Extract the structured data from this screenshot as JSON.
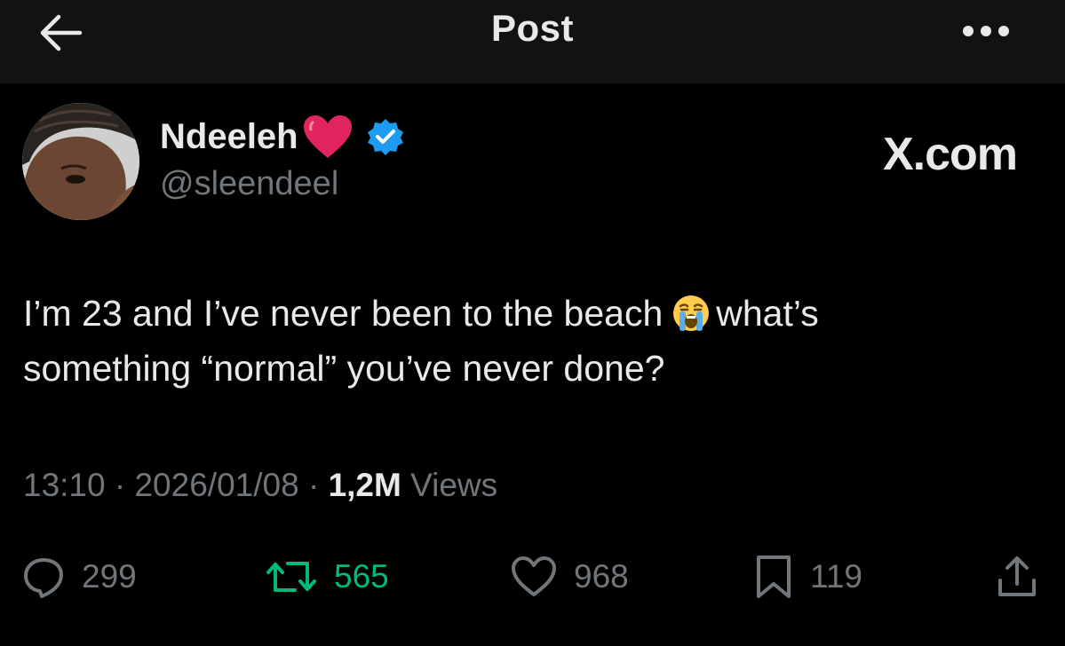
{
  "header": {
    "back_icon": "arrow-left-icon",
    "title": "Post",
    "more_icon": "more-horizontal-icon"
  },
  "author": {
    "display_name": "Ndeeleh",
    "name_emoji": "❤️",
    "verified": true,
    "handle": "@sleendeel"
  },
  "brand": "X.com",
  "tweet": {
    "line1_before_emoji": "I’m 23 and I’ve never been to the beach",
    "emoji": "😭",
    "line1_after_emoji": "what’s",
    "line2": "something “normal” you’ve never done?"
  },
  "meta": {
    "time": "13:10",
    "date": "2026/01/08",
    "separator": "·",
    "views_count": "1,2M",
    "views_label": "Views"
  },
  "actions": {
    "replies": "299",
    "reposts": "565",
    "likes": "968",
    "bookmarks": "119"
  },
  "colors": {
    "background": "#000000",
    "header_bg": "#121212",
    "text_primary": "#e7e9ea",
    "text_secondary": "#71767b",
    "verified_blue": "#1d9bf0",
    "repost_green": "#00ba7c",
    "heart_red": "#e0245e"
  }
}
